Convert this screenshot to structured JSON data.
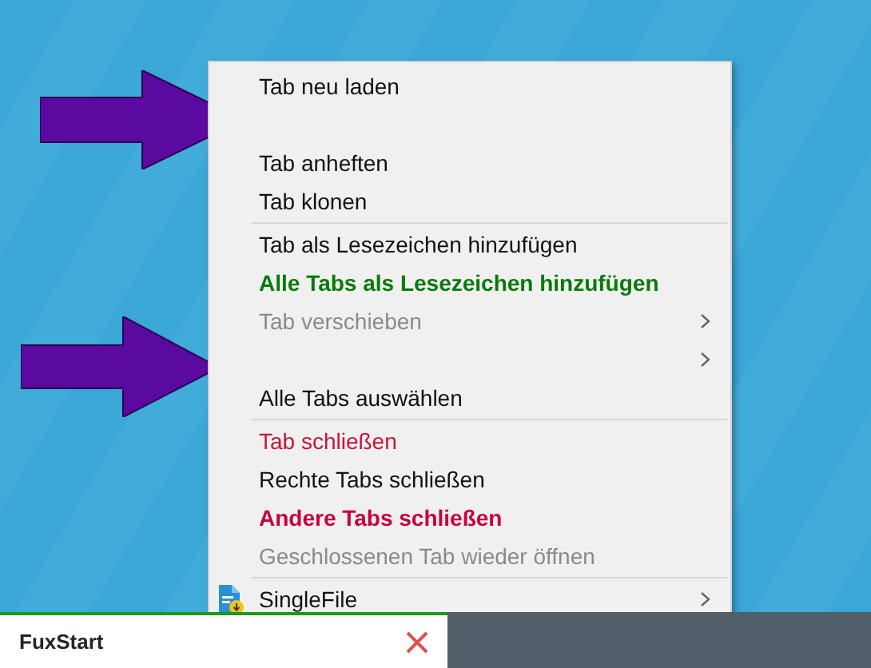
{
  "context_menu": {
    "items": [
      {
        "kind": "item",
        "label": "Tab neu laden",
        "bold": false,
        "disabled": false,
        "submenu": false
      },
      {
        "kind": "blank"
      },
      {
        "kind": "item",
        "label": "Tab anheften",
        "bold": false,
        "disabled": false,
        "submenu": false
      },
      {
        "kind": "item",
        "label": "Tab klonen",
        "bold": false,
        "disabled": false,
        "submenu": false
      },
      {
        "kind": "separator"
      },
      {
        "kind": "item",
        "label": "Tab als Lesezeichen hinzufügen",
        "bold": false,
        "disabled": false,
        "submenu": false
      },
      {
        "kind": "item",
        "label": "Alle Tabs als Lesezeichen hinzufügen",
        "color": "#0a7a0a",
        "bold": true,
        "disabled": false,
        "submenu": false
      },
      {
        "kind": "item",
        "label": "Tab verschieben",
        "bold": false,
        "disabled": true,
        "submenu": true
      },
      {
        "kind": "blank",
        "submenu": true
      },
      {
        "kind": "item",
        "label": "Alle Tabs auswählen",
        "bold": false,
        "disabled": false,
        "submenu": false
      },
      {
        "kind": "separator"
      },
      {
        "kind": "item",
        "label": "Tab schließen",
        "color": "#c8143c",
        "bold": false,
        "disabled": false,
        "submenu": false
      },
      {
        "kind": "item",
        "label": "Rechte Tabs schließen",
        "bold": false,
        "disabled": false,
        "submenu": false
      },
      {
        "kind": "item",
        "label": "Andere Tabs schließen",
        "color": "#c8003c",
        "bold": true,
        "disabled": false,
        "submenu": false
      },
      {
        "kind": "item",
        "label": "Geschlossenen Tab wieder öffnen",
        "bold": false,
        "disabled": true,
        "submenu": false
      },
      {
        "kind": "separator"
      },
      {
        "kind": "item",
        "label": "SingleFile",
        "bold": false,
        "disabled": false,
        "submenu": true,
        "icon": true
      }
    ]
  },
  "tab": {
    "title": "FuxStart",
    "selected": true
  }
}
